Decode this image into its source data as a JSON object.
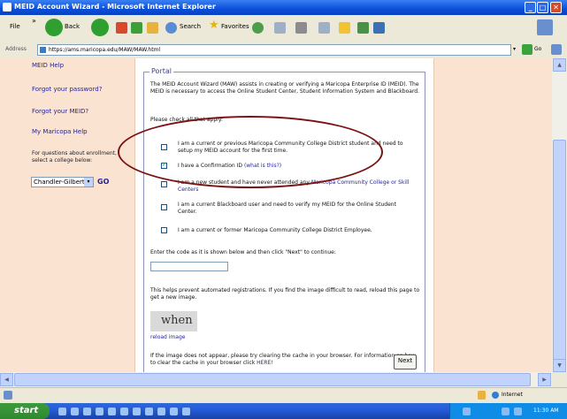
{
  "window": {
    "title": "MEID Account Wizard - Microsoft Internet Explorer"
  },
  "menu": {
    "file": "File"
  },
  "toolbar": {
    "back": "Back",
    "search": "Search",
    "favorites": "Favorites"
  },
  "address": {
    "label": "Address",
    "url": "https://ams.maricopa.edu/MAW/MAW.html",
    "go": "Go"
  },
  "sidebar": {
    "cut_item": "MEID Help",
    "forgot_password": "Forgot your password?",
    "forgot_meid": "Forgot your MEID?",
    "maricopa_help": "My Maricopa Help",
    "questions": "For questions about enrollment, select a college below:",
    "college_selected": "Chandler-Gilbert",
    "go": "GO"
  },
  "portal": {
    "legend": "Portal",
    "intro": "The MEID Account Wizard (MAW) assists in creating or verifying a Maricopa Enterprise ID (MEID). The MEID is necessary to access the Online Student Center, Student Information System and Blackboard.",
    "instruction": "Please check all that apply:",
    "options": [
      {
        "text": "I am a current or previous Maricopa Community College District student and need to setup my MEID account for the first time.",
        "checked": false
      },
      {
        "text": "I have a Confirmation ID",
        "link": "(what is this?)",
        "checked": true
      },
      {
        "text": "I am a new student and have never attended any",
        "link": "Maricopa Community College or Skill Centers",
        "checked": false
      },
      {
        "text": "I am a current Blackboard user and need to verify my MEID for the Online Student Center.",
        "checked": false
      },
      {
        "text": "I am a current or former Maricopa Community College District Employee.",
        "checked": false
      }
    ],
    "code_instruction": "Enter the code as it is shown below and then click \"Next\" to continue:",
    "help_text": "This helps prevent automated registrations. If you find the image difficult to read, reload this page to get a new image.",
    "captcha_text": "when",
    "reload": "reload image",
    "cache_text": "If the image does not appear, please try clearing the cache in your browser. For information on how to clear the cache in your browser click",
    "cache_link": "HERE!",
    "next": "Next"
  },
  "status": {
    "zone": "Internet"
  },
  "taskbar": {
    "start": "start",
    "clock": "11:30 AM"
  },
  "colors": {
    "accent": "#7A1212",
    "page_bg": "#FBE3D2",
    "link": "#1E1EA0"
  }
}
